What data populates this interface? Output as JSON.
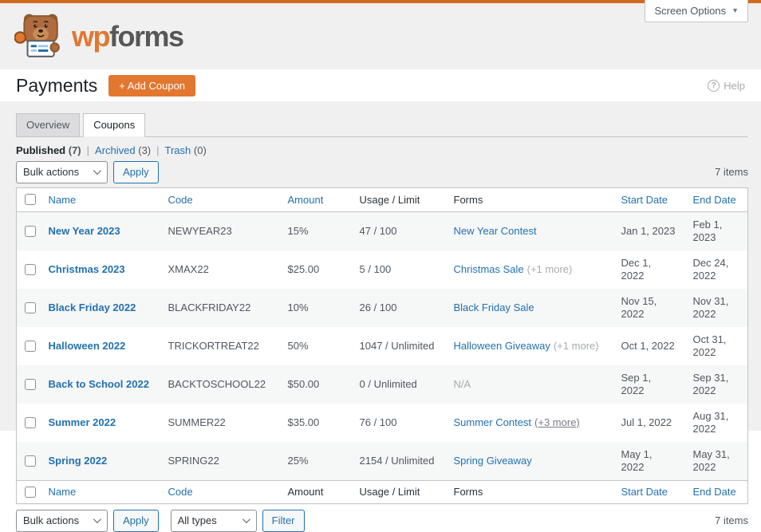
{
  "screen_options": {
    "label": "Screen Options"
  },
  "brand": {
    "wordmark_wp": "wp",
    "wordmark_forms": "forms"
  },
  "page_header": {
    "title": "Payments",
    "add_coupon": "+ Add Coupon",
    "help": "Help",
    "help_icon": "?"
  },
  "tabs": {
    "overview": "Overview",
    "coupons": "Coupons"
  },
  "filters": {
    "published": {
      "label": "Published",
      "count": "(7)"
    },
    "archived": {
      "label": "Archived",
      "count": "(3)"
    },
    "trash": {
      "label": "Trash",
      "count": "(0)"
    }
  },
  "toolbar_top": {
    "bulk_actions": "Bulk actions",
    "apply": "Apply",
    "items": "7 items"
  },
  "toolbar_bottom": {
    "bulk_actions": "Bulk actions",
    "apply": "Apply",
    "all_types": "All types",
    "filter": "Filter",
    "items": "7 items"
  },
  "table": {
    "columns": {
      "name": "Name",
      "code": "Code",
      "amount": "Amount",
      "usage": "Usage / Limit",
      "forms": "Forms",
      "start": "Start Date",
      "end": "End Date"
    },
    "rows": [
      {
        "name": "New Year 2023",
        "code": "NEWYEAR23",
        "amount": "15%",
        "usage": "47 / 100",
        "form": "New Year Contest",
        "form_extra": "",
        "start": "Jan 1, 2023",
        "end": "Feb 1, 2023"
      },
      {
        "name": "Christmas 2023",
        "code": "XMAX22",
        "amount": "$25.00",
        "usage": "5 / 100",
        "form": "Christmas Sale",
        "form_extra": "(+1 more)",
        "start": "Dec 1, 2022",
        "end": "Dec 24, 2022"
      },
      {
        "name": "Black Friday 2022",
        "code": "BLACKFRIDAY22",
        "amount": "10%",
        "usage": "26 / 100",
        "form": "Black Friday Sale",
        "form_extra": "",
        "start": "Nov 15, 2022",
        "end": "Nov 31, 2022"
      },
      {
        "name": "Halloween 2022",
        "code": "TRICKORTREAT22",
        "amount": "50%",
        "usage": "1047 / Unlimited",
        "form": "Halloween Giveaway",
        "form_extra": "(+1 more)",
        "start": "Oct 1, 2022",
        "end": "Oct 31, 2022"
      },
      {
        "name": "Back to School 2022",
        "code": "BACKTOSCHOOL22",
        "amount": "$50.00",
        "usage": "0 / Unlimited",
        "form": "N/A",
        "form_extra": "",
        "start": "Sep 1, 2022",
        "end": "Sep 31, 2022"
      },
      {
        "name": "Summer 2022",
        "code": "SUMMER22",
        "amount": "$35.00",
        "usage": "76 / 100",
        "form": "Summer Contest",
        "form_extra": "(+3 more)",
        "start": "Jul 1, 2022",
        "end": "Aug 31, 2022"
      },
      {
        "name": "Spring 2022",
        "code": "SPRING22",
        "amount": "25%",
        "usage": "2154 / Unlimited",
        "form": "Spring Giveaway",
        "form_extra": "",
        "start": "May 1, 2022",
        "end": "May 31, 2022"
      }
    ]
  },
  "colors": {
    "accent_orange": "#e27730",
    "topbar_orange": "#d2691e",
    "link_blue": "#2271b1"
  }
}
